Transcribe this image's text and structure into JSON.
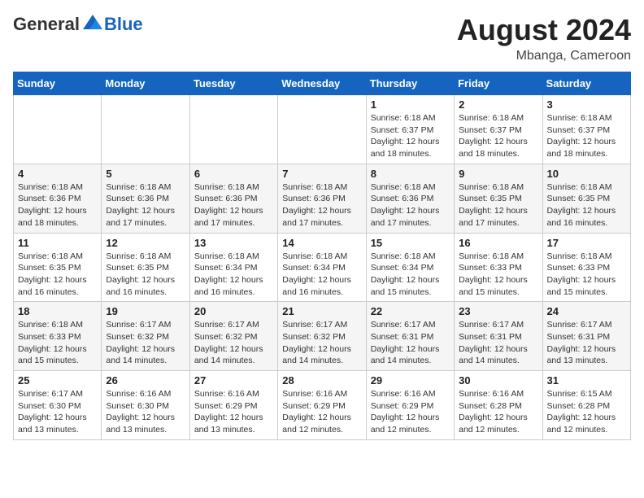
{
  "header": {
    "logo_general": "General",
    "logo_blue": "Blue",
    "month_year": "August 2024",
    "location": "Mbanga, Cameroon"
  },
  "weekdays": [
    "Sunday",
    "Monday",
    "Tuesday",
    "Wednesday",
    "Thursday",
    "Friday",
    "Saturday"
  ],
  "weeks": [
    [
      {
        "day": "",
        "info": ""
      },
      {
        "day": "",
        "info": ""
      },
      {
        "day": "",
        "info": ""
      },
      {
        "day": "",
        "info": ""
      },
      {
        "day": "1",
        "info": "Sunrise: 6:18 AM\nSunset: 6:37 PM\nDaylight: 12 hours\nand 18 minutes."
      },
      {
        "day": "2",
        "info": "Sunrise: 6:18 AM\nSunset: 6:37 PM\nDaylight: 12 hours\nand 18 minutes."
      },
      {
        "day": "3",
        "info": "Sunrise: 6:18 AM\nSunset: 6:37 PM\nDaylight: 12 hours\nand 18 minutes."
      }
    ],
    [
      {
        "day": "4",
        "info": "Sunrise: 6:18 AM\nSunset: 6:36 PM\nDaylight: 12 hours\nand 18 minutes."
      },
      {
        "day": "5",
        "info": "Sunrise: 6:18 AM\nSunset: 6:36 PM\nDaylight: 12 hours\nand 17 minutes."
      },
      {
        "day": "6",
        "info": "Sunrise: 6:18 AM\nSunset: 6:36 PM\nDaylight: 12 hours\nand 17 minutes."
      },
      {
        "day": "7",
        "info": "Sunrise: 6:18 AM\nSunset: 6:36 PM\nDaylight: 12 hours\nand 17 minutes."
      },
      {
        "day": "8",
        "info": "Sunrise: 6:18 AM\nSunset: 6:36 PM\nDaylight: 12 hours\nand 17 minutes."
      },
      {
        "day": "9",
        "info": "Sunrise: 6:18 AM\nSunset: 6:35 PM\nDaylight: 12 hours\nand 17 minutes."
      },
      {
        "day": "10",
        "info": "Sunrise: 6:18 AM\nSunset: 6:35 PM\nDaylight: 12 hours\nand 16 minutes."
      }
    ],
    [
      {
        "day": "11",
        "info": "Sunrise: 6:18 AM\nSunset: 6:35 PM\nDaylight: 12 hours\nand 16 minutes."
      },
      {
        "day": "12",
        "info": "Sunrise: 6:18 AM\nSunset: 6:35 PM\nDaylight: 12 hours\nand 16 minutes."
      },
      {
        "day": "13",
        "info": "Sunrise: 6:18 AM\nSunset: 6:34 PM\nDaylight: 12 hours\nand 16 minutes."
      },
      {
        "day": "14",
        "info": "Sunrise: 6:18 AM\nSunset: 6:34 PM\nDaylight: 12 hours\nand 16 minutes."
      },
      {
        "day": "15",
        "info": "Sunrise: 6:18 AM\nSunset: 6:34 PM\nDaylight: 12 hours\nand 15 minutes."
      },
      {
        "day": "16",
        "info": "Sunrise: 6:18 AM\nSunset: 6:33 PM\nDaylight: 12 hours\nand 15 minutes."
      },
      {
        "day": "17",
        "info": "Sunrise: 6:18 AM\nSunset: 6:33 PM\nDaylight: 12 hours\nand 15 minutes."
      }
    ],
    [
      {
        "day": "18",
        "info": "Sunrise: 6:18 AM\nSunset: 6:33 PM\nDaylight: 12 hours\nand 15 minutes."
      },
      {
        "day": "19",
        "info": "Sunrise: 6:17 AM\nSunset: 6:32 PM\nDaylight: 12 hours\nand 14 minutes."
      },
      {
        "day": "20",
        "info": "Sunrise: 6:17 AM\nSunset: 6:32 PM\nDaylight: 12 hours\nand 14 minutes."
      },
      {
        "day": "21",
        "info": "Sunrise: 6:17 AM\nSunset: 6:32 PM\nDaylight: 12 hours\nand 14 minutes."
      },
      {
        "day": "22",
        "info": "Sunrise: 6:17 AM\nSunset: 6:31 PM\nDaylight: 12 hours\nand 14 minutes."
      },
      {
        "day": "23",
        "info": "Sunrise: 6:17 AM\nSunset: 6:31 PM\nDaylight: 12 hours\nand 14 minutes."
      },
      {
        "day": "24",
        "info": "Sunrise: 6:17 AM\nSunset: 6:31 PM\nDaylight: 12 hours\nand 13 minutes."
      }
    ],
    [
      {
        "day": "25",
        "info": "Sunrise: 6:17 AM\nSunset: 6:30 PM\nDaylight: 12 hours\nand 13 minutes."
      },
      {
        "day": "26",
        "info": "Sunrise: 6:16 AM\nSunset: 6:30 PM\nDaylight: 12 hours\nand 13 minutes."
      },
      {
        "day": "27",
        "info": "Sunrise: 6:16 AM\nSunset: 6:29 PM\nDaylight: 12 hours\nand 13 minutes."
      },
      {
        "day": "28",
        "info": "Sunrise: 6:16 AM\nSunset: 6:29 PM\nDaylight: 12 hours\nand 12 minutes."
      },
      {
        "day": "29",
        "info": "Sunrise: 6:16 AM\nSunset: 6:29 PM\nDaylight: 12 hours\nand 12 minutes."
      },
      {
        "day": "30",
        "info": "Sunrise: 6:16 AM\nSunset: 6:28 PM\nDaylight: 12 hours\nand 12 minutes."
      },
      {
        "day": "31",
        "info": "Sunrise: 6:15 AM\nSunset: 6:28 PM\nDaylight: 12 hours\nand 12 minutes."
      }
    ]
  ]
}
